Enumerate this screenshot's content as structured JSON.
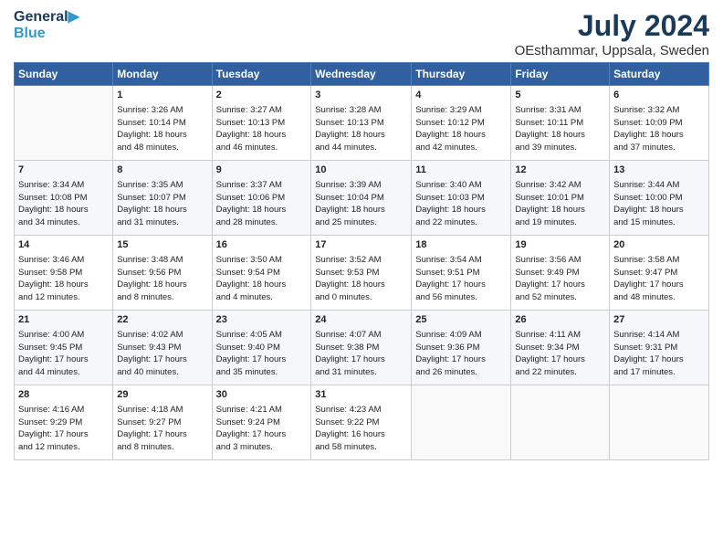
{
  "header": {
    "logo_line1": "General",
    "logo_line2": "Blue",
    "month": "July 2024",
    "location": "OEsthammar, Uppsala, Sweden"
  },
  "weekdays": [
    "Sunday",
    "Monday",
    "Tuesday",
    "Wednesday",
    "Thursday",
    "Friday",
    "Saturday"
  ],
  "weeks": [
    [
      {
        "day": "",
        "content": ""
      },
      {
        "day": "1",
        "content": "Sunrise: 3:26 AM\nSunset: 10:14 PM\nDaylight: 18 hours\nand 48 minutes."
      },
      {
        "day": "2",
        "content": "Sunrise: 3:27 AM\nSunset: 10:13 PM\nDaylight: 18 hours\nand 46 minutes."
      },
      {
        "day": "3",
        "content": "Sunrise: 3:28 AM\nSunset: 10:13 PM\nDaylight: 18 hours\nand 44 minutes."
      },
      {
        "day": "4",
        "content": "Sunrise: 3:29 AM\nSunset: 10:12 PM\nDaylight: 18 hours\nand 42 minutes."
      },
      {
        "day": "5",
        "content": "Sunrise: 3:31 AM\nSunset: 10:11 PM\nDaylight: 18 hours\nand 39 minutes."
      },
      {
        "day": "6",
        "content": "Sunrise: 3:32 AM\nSunset: 10:09 PM\nDaylight: 18 hours\nand 37 minutes."
      }
    ],
    [
      {
        "day": "7",
        "content": "Sunrise: 3:34 AM\nSunset: 10:08 PM\nDaylight: 18 hours\nand 34 minutes."
      },
      {
        "day": "8",
        "content": "Sunrise: 3:35 AM\nSunset: 10:07 PM\nDaylight: 18 hours\nand 31 minutes."
      },
      {
        "day": "9",
        "content": "Sunrise: 3:37 AM\nSunset: 10:06 PM\nDaylight: 18 hours\nand 28 minutes."
      },
      {
        "day": "10",
        "content": "Sunrise: 3:39 AM\nSunset: 10:04 PM\nDaylight: 18 hours\nand 25 minutes."
      },
      {
        "day": "11",
        "content": "Sunrise: 3:40 AM\nSunset: 10:03 PM\nDaylight: 18 hours\nand 22 minutes."
      },
      {
        "day": "12",
        "content": "Sunrise: 3:42 AM\nSunset: 10:01 PM\nDaylight: 18 hours\nand 19 minutes."
      },
      {
        "day": "13",
        "content": "Sunrise: 3:44 AM\nSunset: 10:00 PM\nDaylight: 18 hours\nand 15 minutes."
      }
    ],
    [
      {
        "day": "14",
        "content": "Sunrise: 3:46 AM\nSunset: 9:58 PM\nDaylight: 18 hours\nand 12 minutes."
      },
      {
        "day": "15",
        "content": "Sunrise: 3:48 AM\nSunset: 9:56 PM\nDaylight: 18 hours\nand 8 minutes."
      },
      {
        "day": "16",
        "content": "Sunrise: 3:50 AM\nSunset: 9:54 PM\nDaylight: 18 hours\nand 4 minutes."
      },
      {
        "day": "17",
        "content": "Sunrise: 3:52 AM\nSunset: 9:53 PM\nDaylight: 18 hours\nand 0 minutes."
      },
      {
        "day": "18",
        "content": "Sunrise: 3:54 AM\nSunset: 9:51 PM\nDaylight: 17 hours\nand 56 minutes."
      },
      {
        "day": "19",
        "content": "Sunrise: 3:56 AM\nSunset: 9:49 PM\nDaylight: 17 hours\nand 52 minutes."
      },
      {
        "day": "20",
        "content": "Sunrise: 3:58 AM\nSunset: 9:47 PM\nDaylight: 17 hours\nand 48 minutes."
      }
    ],
    [
      {
        "day": "21",
        "content": "Sunrise: 4:00 AM\nSunset: 9:45 PM\nDaylight: 17 hours\nand 44 minutes."
      },
      {
        "day": "22",
        "content": "Sunrise: 4:02 AM\nSunset: 9:43 PM\nDaylight: 17 hours\nand 40 minutes."
      },
      {
        "day": "23",
        "content": "Sunrise: 4:05 AM\nSunset: 9:40 PM\nDaylight: 17 hours\nand 35 minutes."
      },
      {
        "day": "24",
        "content": "Sunrise: 4:07 AM\nSunset: 9:38 PM\nDaylight: 17 hours\nand 31 minutes."
      },
      {
        "day": "25",
        "content": "Sunrise: 4:09 AM\nSunset: 9:36 PM\nDaylight: 17 hours\nand 26 minutes."
      },
      {
        "day": "26",
        "content": "Sunrise: 4:11 AM\nSunset: 9:34 PM\nDaylight: 17 hours\nand 22 minutes."
      },
      {
        "day": "27",
        "content": "Sunrise: 4:14 AM\nSunset: 9:31 PM\nDaylight: 17 hours\nand 17 minutes."
      }
    ],
    [
      {
        "day": "28",
        "content": "Sunrise: 4:16 AM\nSunset: 9:29 PM\nDaylight: 17 hours\nand 12 minutes."
      },
      {
        "day": "29",
        "content": "Sunrise: 4:18 AM\nSunset: 9:27 PM\nDaylight: 17 hours\nand 8 minutes."
      },
      {
        "day": "30",
        "content": "Sunrise: 4:21 AM\nSunset: 9:24 PM\nDaylight: 17 hours\nand 3 minutes."
      },
      {
        "day": "31",
        "content": "Sunrise: 4:23 AM\nSunset: 9:22 PM\nDaylight: 16 hours\nand 58 minutes."
      },
      {
        "day": "",
        "content": ""
      },
      {
        "day": "",
        "content": ""
      },
      {
        "day": "",
        "content": ""
      }
    ]
  ]
}
